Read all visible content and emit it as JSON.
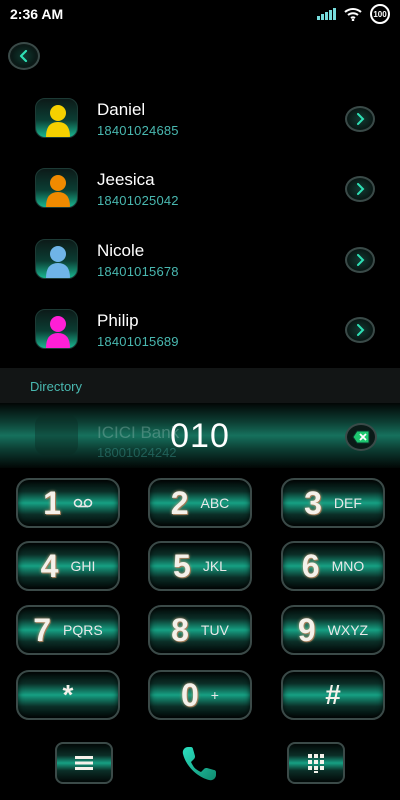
{
  "status_bar": {
    "time": "2:36 AM",
    "battery": "100"
  },
  "contacts": [
    {
      "name": "Daniel",
      "number": "18401024685",
      "avatar_color": "#f5d000"
    },
    {
      "name": "Jeesica",
      "number": "18401025042",
      "avatar_color": "#f08a00"
    },
    {
      "name": "Nicole",
      "number": "18401015678",
      "avatar_color": "#6fb4e8"
    },
    {
      "name": "Philip",
      "number": "18401015689",
      "avatar_color": "#ff1fd6"
    }
  ],
  "directory": {
    "label": "Directory",
    "partial_entry": {
      "name": "ICICI Bank",
      "number": "18001024242"
    }
  },
  "dialer": {
    "number": "010"
  },
  "keypad": [
    {
      "digit": "1",
      "letters": ""
    },
    {
      "digit": "2",
      "letters": "ABC"
    },
    {
      "digit": "3",
      "letters": "DEF"
    },
    {
      "digit": "4",
      "letters": "GHI"
    },
    {
      "digit": "5",
      "letters": "JKL"
    },
    {
      "digit": "6",
      "letters": "MNO"
    },
    {
      "digit": "7",
      "letters": "PQRS"
    },
    {
      "digit": "8",
      "letters": "TUV"
    },
    {
      "digit": "9",
      "letters": "WXYZ"
    },
    {
      "digit": "*",
      "letters": ""
    },
    {
      "digit": "0",
      "letters": "+"
    },
    {
      "digit": "#",
      "letters": ""
    }
  ],
  "colors": {
    "accent": "#16a083",
    "teal_text": "#49b8b0",
    "call_green": "#1ec8a0"
  },
  "icons": [
    "back-icon",
    "chevron-right-icon",
    "person-icon",
    "backspace-icon",
    "voicemail-icon",
    "menu-icon",
    "phone-icon",
    "dialpad-icon",
    "wifi-icon",
    "signal-icon",
    "battery-icon"
  ]
}
